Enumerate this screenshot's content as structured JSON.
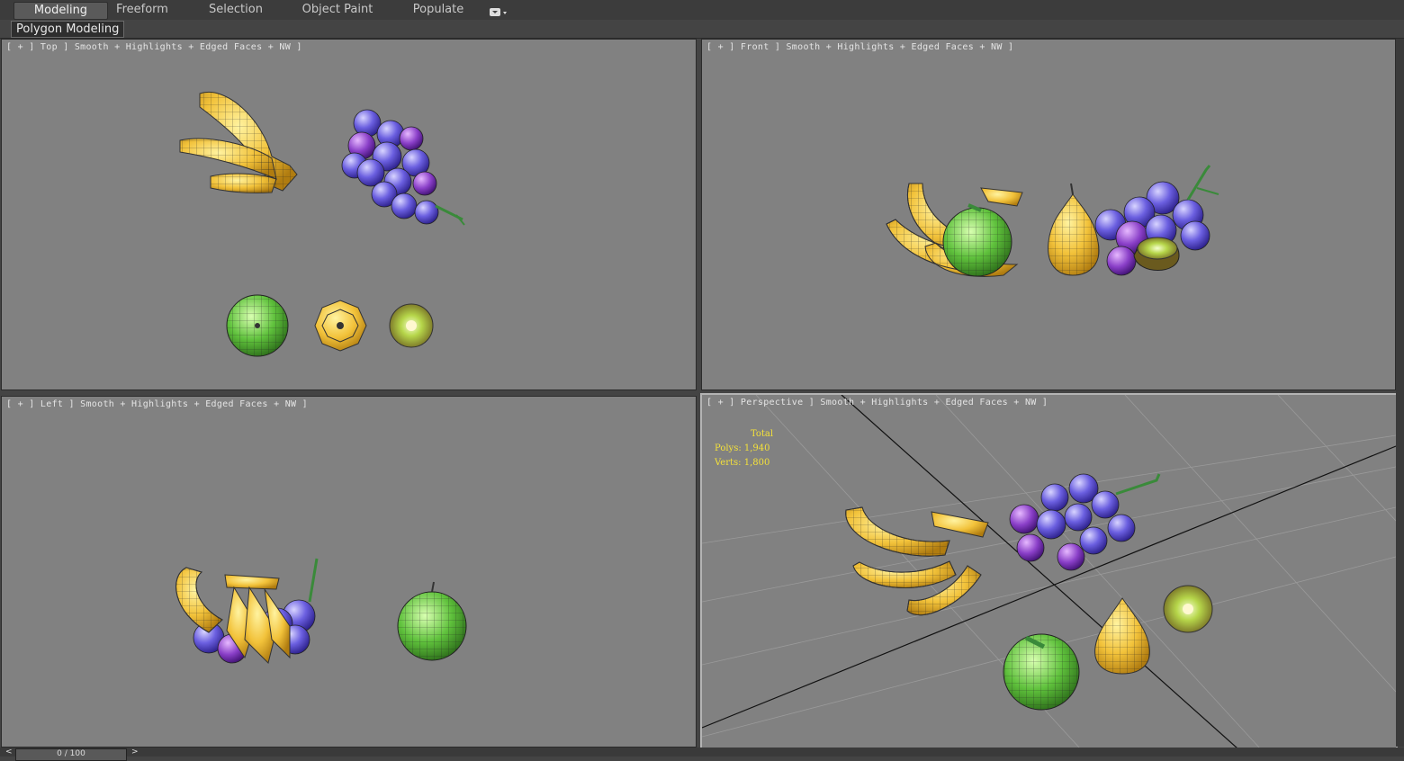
{
  "ribbon": {
    "tabs": [
      {
        "label": "Modeling",
        "active": true
      },
      {
        "label": "Freeform",
        "active": false
      },
      {
        "label": "Selection",
        "active": false
      },
      {
        "label": "Object Paint",
        "active": false
      },
      {
        "label": "Populate",
        "active": false
      }
    ],
    "panel_label": "Polygon Modeling",
    "menu_icon": "dropdown-arrow-icon"
  },
  "viewports": {
    "top": {
      "label": "[ + ] Top ] Smooth + Highlights + Edged Faces + NW ]"
    },
    "front": {
      "label": "[ + ] Front ] Smooth + Highlights + Edged Faces + NW ]"
    },
    "left": {
      "label": "[ + ] Left ] Smooth + Highlights + Edged Faces + NW ]"
    },
    "perspective": {
      "label": "[ + ] Perspective ] Smooth + Highlights + Edged Faces + NW ]"
    }
  },
  "stats": {
    "title": "Total",
    "polys": "Polys: 1,940",
    "verts": "Verts: 1,800"
  },
  "timeline": {
    "frame_display": "0 / 100",
    "prev_arrow": "<",
    "next_arrow": ">"
  },
  "colors": {
    "viewport_bg": "#818181",
    "banana": "#f2c23a",
    "grape": "#6b5fe0",
    "apple": "#5fc13c",
    "stats_text": "#f4e13a"
  }
}
